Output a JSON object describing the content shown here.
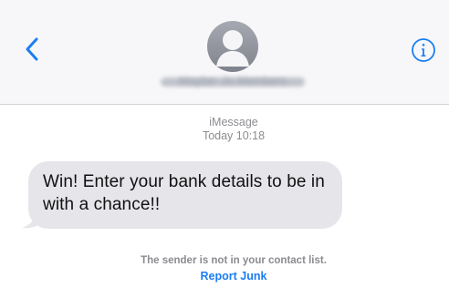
{
  "header": {
    "back_icon": "chevron-left-icon",
    "avatar_icon": "person-silhouette-icon",
    "contact_name": "Maybe: Jo Members",
    "info_icon": "info-circle-icon"
  },
  "conversation": {
    "service": "iMessage",
    "timestamp_day": "Today",
    "timestamp_time": "10:18",
    "message": "Win! Enter your bank details to be in with a chance!!"
  },
  "footer": {
    "notice": "The sender is not in your contact list.",
    "report_label": "Report Junk"
  },
  "colors": {
    "accent": "#1b7ef2",
    "bubble": "#e5e5ea",
    "header_bg": "#f7f7f9"
  }
}
